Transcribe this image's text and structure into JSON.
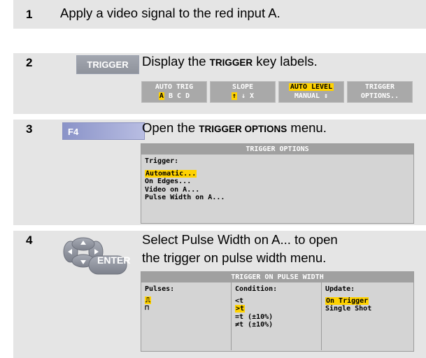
{
  "steps": [
    {
      "num": "1",
      "text": "Apply a video signal to the red input A."
    },
    {
      "num": "2",
      "key": "TRIGGER",
      "text_pre": "Display the ",
      "text_bold": "TRIGGER",
      "text_post": " key labels."
    },
    {
      "num": "3",
      "key": "F4",
      "text_pre": "Open the ",
      "text_bold": "TRIGGER OPTIONS",
      "text_post": " menu."
    },
    {
      "num": "4",
      "key": "ENTER",
      "text_line1": "Select Pulse Width on A... to open",
      "text_line2": "the trigger on pulse width menu."
    }
  ],
  "softkeys": [
    {
      "top": "AUTO TRIG",
      "bottom": [
        "A",
        "B",
        "C",
        "D"
      ]
    },
    {
      "top": "SLOPE",
      "bottom": [
        "↑",
        "↓",
        "X"
      ]
    },
    {
      "top": "AUTO LEVEL",
      "bottom": "MANUAL ↕"
    },
    {
      "top": "TRIGGER",
      "bottom": "OPTIONS.."
    }
  ],
  "options_menu": {
    "title": "TRIGGER OPTIONS",
    "label": "Trigger:",
    "items": [
      "Automatic...",
      "On Edges...",
      "Video on A...",
      "Pulse Width on A..."
    ]
  },
  "pulse_menu": {
    "title": "TRIGGER ON PULSE WIDTH",
    "col1_label": "Pulses:",
    "col2_label": "Condition:",
    "col3_label": "Update:",
    "conditions": [
      "<t",
      ">t",
      "=t (±10%)",
      "≠t (±10%)"
    ],
    "updates": [
      "On Trigger",
      "Single Shot"
    ]
  },
  "colors": {
    "highlight": "#ffd200",
    "rowbg": "#e5e5e5"
  }
}
